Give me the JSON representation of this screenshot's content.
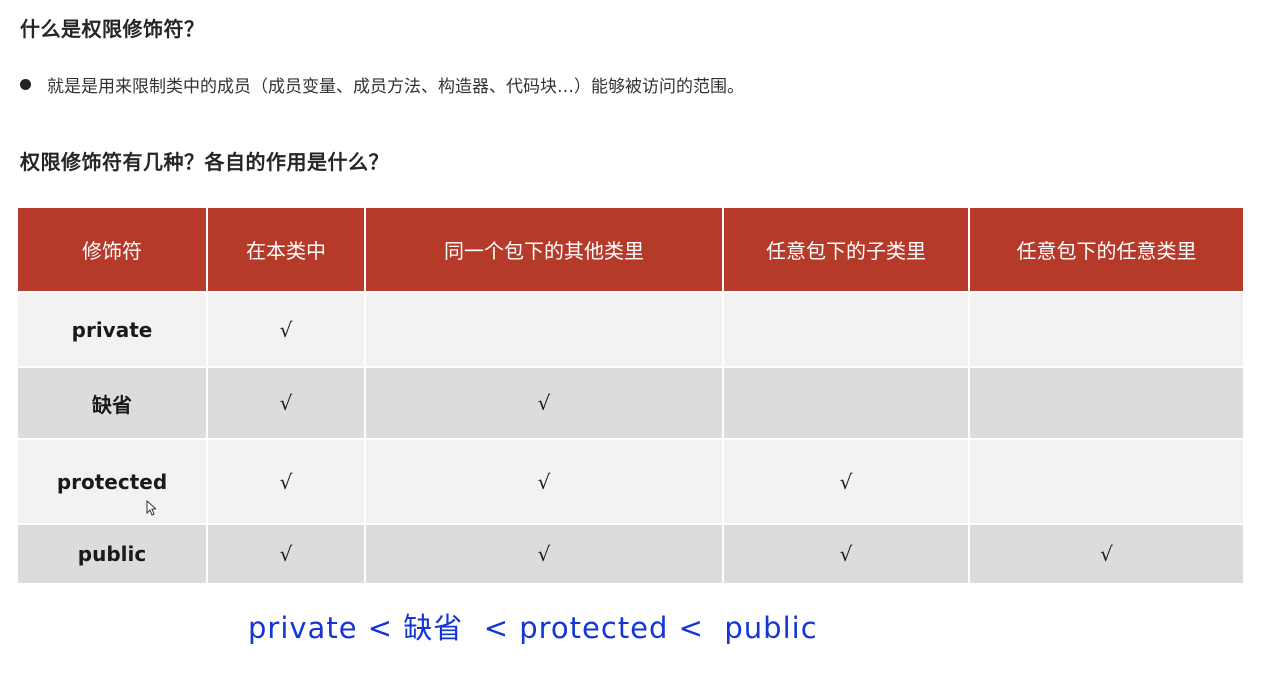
{
  "heading1": "什么是权限修饰符？",
  "bullet": "就是是用来限制类中的成员（成员变量、成员方法、构造器、代码块…）能够被访问的范围。",
  "heading2": "权限修饰符有几种？各自的作用是什么？",
  "table": {
    "headers": [
      "修饰符",
      "在本类中",
      "同一个包下的其他类里",
      "任意包下的子类里",
      "任意包下的任意类里"
    ],
    "rows": [
      {
        "modifier": "private",
        "cells": [
          "√",
          "",
          "",
          ""
        ]
      },
      {
        "modifier": "缺省",
        "cells": [
          "√",
          "√",
          "",
          ""
        ]
      },
      {
        "modifier": "protected",
        "cells": [
          "√",
          "√",
          "√",
          ""
        ]
      },
      {
        "modifier": "public",
        "cells": [
          "√",
          "√",
          "√",
          "√"
        ]
      }
    ]
  },
  "annotation": "private < 缺省  < protected <  public",
  "colors": {
    "header_bg": "#b53a2a",
    "row_light": "#f2f2f2",
    "row_dark": "#dcdcdc",
    "annotation": "#1535d6"
  }
}
